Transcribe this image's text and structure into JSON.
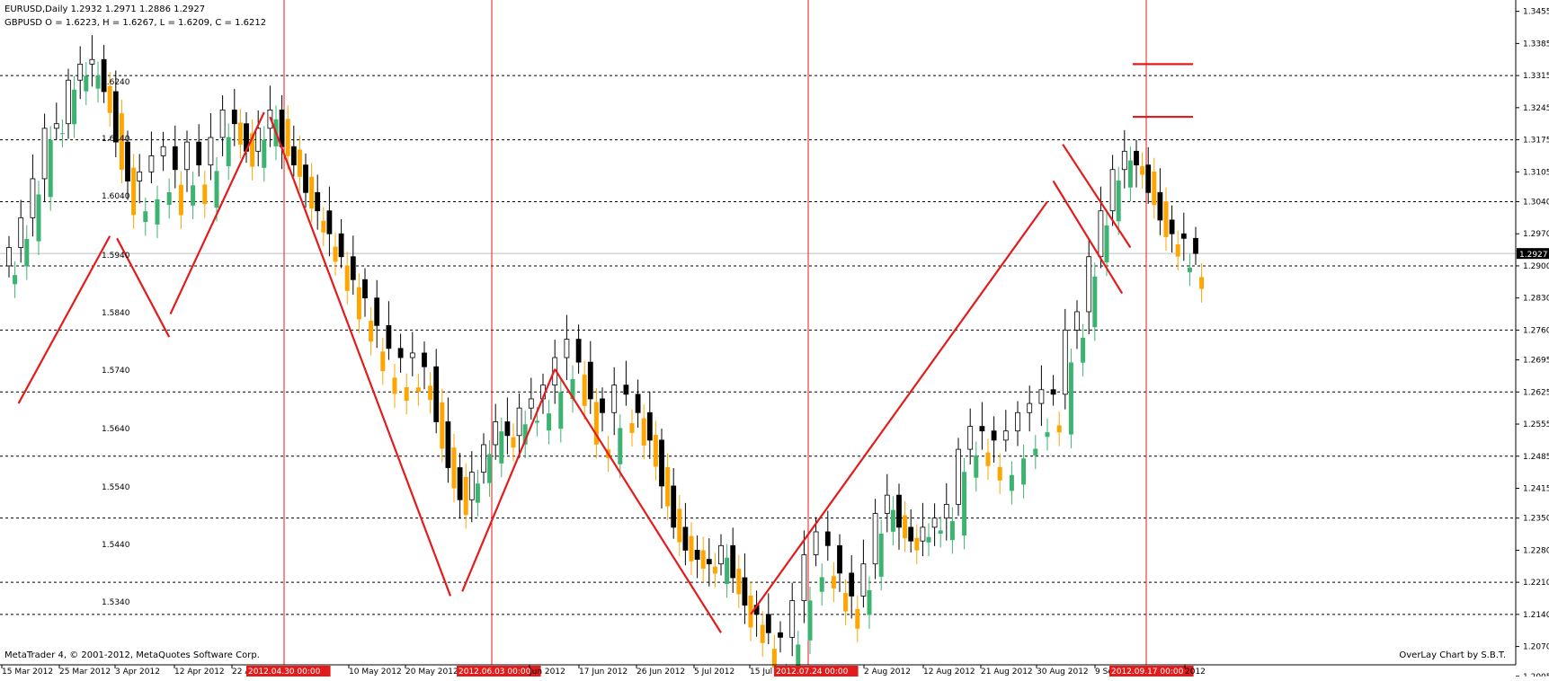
{
  "header": {
    "line1": "EURUSD,Daily  1.2932 1.2971 1.2886 1.2927",
    "line2": "GBPUSD O = 1.6223, H = 1.6267, L = 1.6209, C = 1.6212"
  },
  "footer": {
    "copyright": "MetaTrader 4, © 2001-2012, MetaQuotes Software Corp.",
    "overlay_credit": "OverLay Chart by S.B.T."
  },
  "colors": {
    "eur_bull": "#ffffff",
    "eur_bear": "#000000",
    "gbp_bull": "#3cb371",
    "gbp_bear": "#ffa500",
    "vline": "#e31b1b",
    "trend": "#e31b1b",
    "grid": "#000000",
    "price_badge_bg": "#000000"
  },
  "chart_data": {
    "type": "candlestick",
    "series": [
      {
        "name": "EURUSD",
        "axis": "right"
      },
      {
        "name": "GBPUSD",
        "axis": "left-overlay"
      }
    ],
    "right_axis": {
      "ylim": [
        1.203,
        1.347
      ],
      "ticks": [
        "1.3455",
        "1.3385",
        "1.3315",
        "1.3245",
        "1.3175",
        "1.3105",
        "1.3040",
        "1.2970",
        "1.2900",
        "1.2830",
        "1.2760",
        "1.2695",
        "1.2625",
        "1.2555",
        "1.2485",
        "1.2415",
        "1.2350",
        "1.2280",
        "1.2210",
        "1.2140",
        "1.2070",
        "1.2005"
      ],
      "current_price": "1.2927"
    },
    "overlay_axis": {
      "labels": [
        "1.6240",
        "1.6140",
        "1.6040",
        "1.5940",
        "1.5840",
        "1.5740",
        "1.5640",
        "1.5540",
        "1.5440",
        "1.5340"
      ]
    },
    "x_labels": [
      "15 Mar 2012",
      "25 Mar 2012",
      "3 Apr 2012",
      "12 Apr 2012",
      "22 A",
      "2012.04.30 00:00",
      "10 May 2012",
      "20 May 2012",
      "2012.06.03 00:00",
      "Jun 2012",
      "17 Jun 2012",
      "26 Jun 2012",
      "5 Jul 2012",
      "15 Jul",
      "2012.07.24 00:00",
      "2 Aug 2012",
      "12 Aug 2012",
      "21 Aug 2012",
      "30 Aug 2012",
      "9 Se",
      "2012.09.17 00:00",
      "2012"
    ],
    "vertical_markers": [
      "2012.04.30 00:00",
      "2012.06.03 00:00",
      "2012.07.24 00:00",
      "2012.09.17 00:00"
    ],
    "eurusd_close_path": [
      1.294,
      1.3005,
      1.309,
      1.32,
      1.321,
      1.3305,
      1.334,
      1.335,
      1.328,
      1.317,
      1.3085,
      1.3105,
      1.314,
      1.316,
      1.311,
      1.317,
      1.312,
      1.318,
      1.324,
      1.321,
      1.315,
      1.32,
      1.324,
      1.316,
      1.312,
      1.306,
      1.302,
      1.297,
      1.292,
      1.287,
      1.283,
      1.277,
      1.272,
      1.27,
      1.271,
      1.268,
      1.256,
      1.246,
      1.239,
      1.245,
      1.251,
      1.256,
      1.253,
      1.259,
      1.261,
      1.264,
      1.27,
      1.274,
      1.269,
      1.261,
      1.258,
      1.264,
      1.262,
      1.258,
      1.252,
      1.242,
      1.233,
      1.228,
      1.226,
      1.225,
      1.229,
      1.222,
      1.216,
      1.214,
      1.21,
      1.209,
      1.217,
      1.227,
      1.232,
      1.229,
      1.223,
      1.218,
      1.225,
      1.236,
      1.24,
      1.233,
      1.23,
      1.233,
      1.235,
      1.238,
      1.25,
      1.255,
      1.254,
      1.252,
      1.254,
      1.258,
      1.26,
      1.263,
      1.262,
      1.276,
      1.28,
      1.292,
      1.302,
      1.311,
      1.315,
      1.312,
      1.306,
      1.3,
      1.297,
      1.296,
      1.2927
    ],
    "gbpusd_channel": {
      "upper": "1.6240",
      "lower": "1.5340"
    }
  }
}
